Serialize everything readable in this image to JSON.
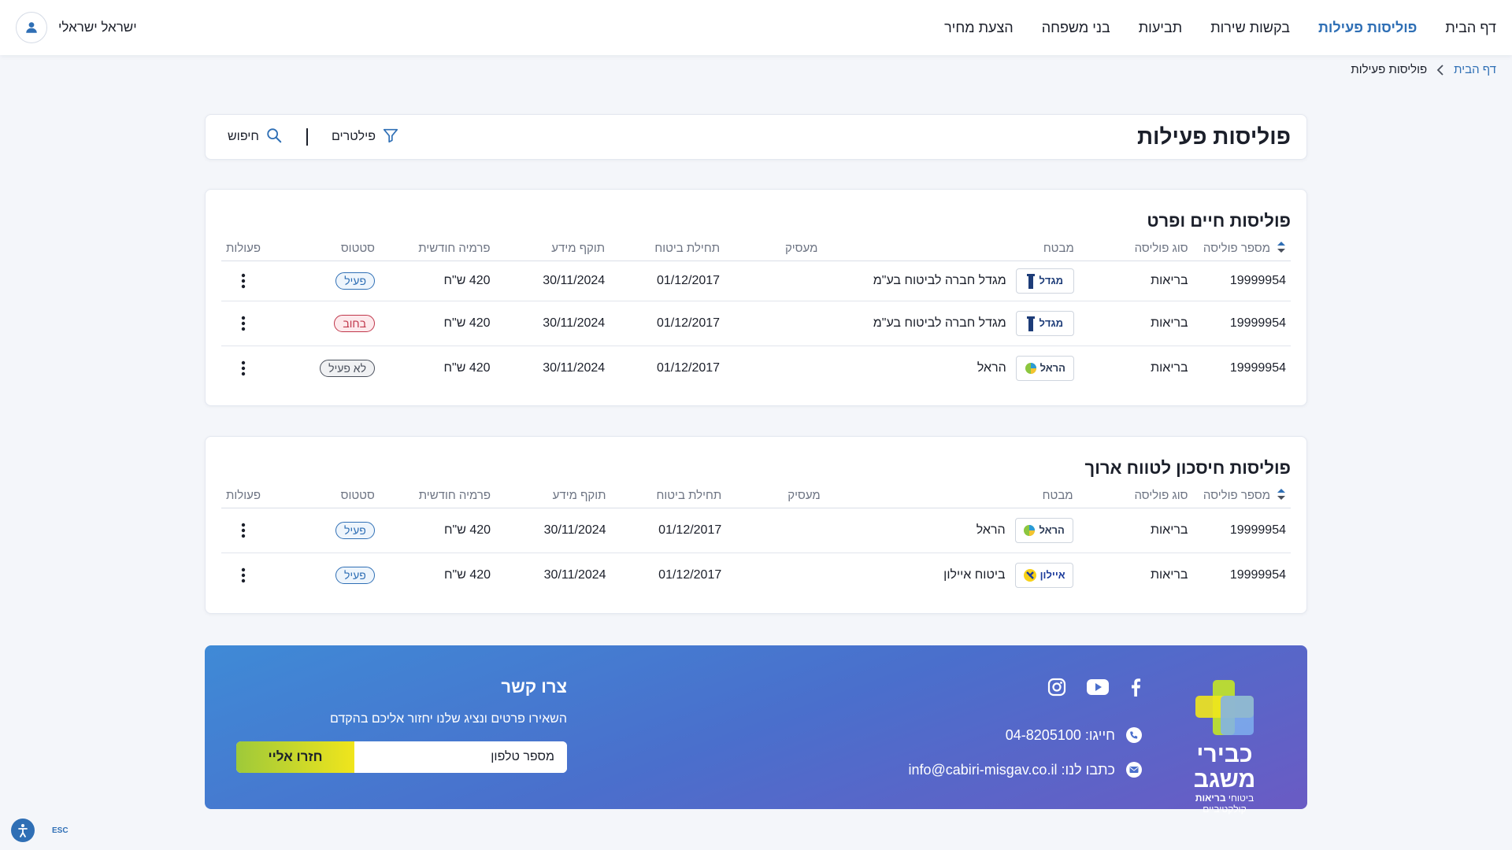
{
  "nav": {
    "items": [
      {
        "label": "דף הבית",
        "active": false
      },
      {
        "label": "פוליסות פעילות",
        "active": true
      },
      {
        "label": "בקשות שירות",
        "active": false
      },
      {
        "label": "תביעות",
        "active": false
      },
      {
        "label": "בני משפחה",
        "active": false
      },
      {
        "label": "הצעת מחיר",
        "active": false
      }
    ],
    "user_name": "ישראל ישראלי"
  },
  "breadcrumb": {
    "home": "דף הבית",
    "current": "פוליסות פעילות"
  },
  "page": {
    "title": "פוליסות פעילות",
    "filters_label": "פילטרים",
    "search_label": "חיפוש"
  },
  "columns": [
    "מספר פוליסה",
    "סוג פוליסה",
    "מבטח",
    "מעסיק",
    "תחילת ביטוח",
    "תוקף מידע",
    "פרמיה חודשית",
    "סטטוס",
    "פעולות"
  ],
  "sections": [
    {
      "title": "פוליסות חיים ופרט",
      "rows": [
        {
          "policy_no": "19999954",
          "type": "בריאות",
          "insurer_logo": "מגדל",
          "insurer": "מגדל חברה לביטוח בע\"מ",
          "employer": "",
          "start": "01/12/2017",
          "valid": "30/11/2024",
          "premium": "420 ש\"ח",
          "status": "פעיל",
          "status_kind": "active"
        },
        {
          "policy_no": "19999954",
          "type": "בריאות",
          "insurer_logo": "מגדל",
          "insurer": "מגדל חברה לביטוח בע\"מ",
          "employer": "",
          "start": "01/12/2017",
          "valid": "30/11/2024",
          "premium": "420 ש\"ח",
          "status": "בחוב",
          "status_kind": "debt"
        },
        {
          "policy_no": "19999954",
          "type": "בריאות",
          "insurer_logo": "הראל",
          "insurer": "הראל",
          "employer": "",
          "start": "01/12/2017",
          "valid": "30/11/2024",
          "premium": "420 ש\"ח",
          "status": "לא פעיל",
          "status_kind": "inactive"
        }
      ]
    },
    {
      "title": "פוליסות חיסכון לטווח ארוך",
      "rows": [
        {
          "policy_no": "19999954",
          "type": "בריאות",
          "insurer_logo": "הראל",
          "insurer": "הראל",
          "employer": "",
          "start": "01/12/2017",
          "valid": "30/11/2024",
          "premium": "420 ש\"ח",
          "status": "פעיל",
          "status_kind": "active"
        },
        {
          "policy_no": "19999954",
          "type": "בריאות",
          "insurer_logo": "איילון",
          "insurer": "ביטוח איילון",
          "employer": "",
          "start": "01/12/2017",
          "valid": "30/11/2024",
          "premium": "420 ש\"ח",
          "status": "פעיל",
          "status_kind": "active"
        }
      ]
    }
  ],
  "footer": {
    "brand_name": "כבירי משגב",
    "brand_tagline_1": "ביטוחי",
    "brand_tagline_2": "בריאות",
    "brand_tagline_3": "קולקטיביים",
    "phone_line": "חייגו: 04-8205100",
    "email_line": "כתבו לנו: info@cabiri-misgav.co.il",
    "social": [
      "facebook-icon",
      "youtube-icon",
      "instagram-icon"
    ],
    "form_title": "צרו קשר",
    "form_desc": "השאירו פרטים ונציג שלנו יחזור אליכם בהקדם",
    "phone_placeholder": "מספר טלפון",
    "cta_label": "חזרו אליי"
  },
  "a11y": {
    "esc_label": "ESC"
  },
  "colors": {
    "accent": "#2f6fb5",
    "debt": "#c0364a",
    "banner_start": "#3f8ad6",
    "banner_end": "#6a5bc4",
    "cta_start": "#9ec93a",
    "cta_end": "#f0e51c"
  }
}
